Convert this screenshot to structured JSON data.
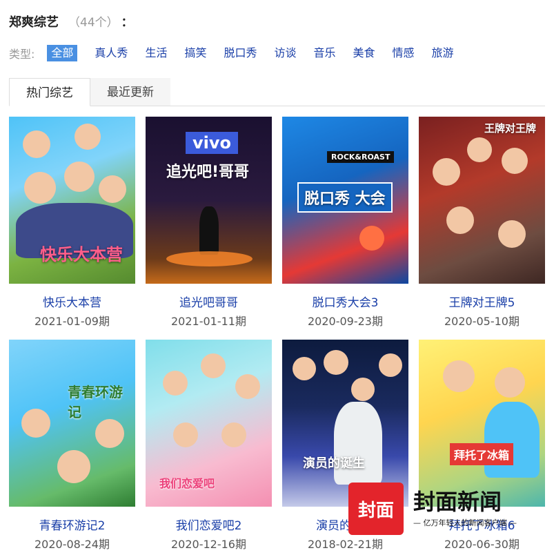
{
  "header": {
    "title": "郑爽综艺",
    "count": "（44个）",
    "colon": "："
  },
  "filters": {
    "label": "类型:",
    "items": [
      "全部",
      "真人秀",
      "生活",
      "搞笑",
      "脱口秀",
      "访谈",
      "音乐",
      "美食",
      "情感",
      "旅游"
    ]
  },
  "tabs": [
    "热门综艺",
    "最近更新"
  ],
  "shows": [
    {
      "name": "快乐大本营",
      "date": "2021-01-09期",
      "poster_text": "快乐大本营"
    },
    {
      "name": "追光吧哥哥",
      "date": "2021-01-11期",
      "poster_text": "追光吧!哥哥",
      "poster_sub": "vivo"
    },
    {
      "name": "脱口秀大会3",
      "date": "2020-09-23期",
      "poster_text": "脱口秀 大会",
      "poster_sub": "ROCK&ROAST"
    },
    {
      "name": "王牌对王牌5",
      "date": "2020-05-10期",
      "poster_text": "王牌对王牌"
    },
    {
      "name": "青春环游记2",
      "date": "2020-08-24期",
      "poster_text": "青春环游记"
    },
    {
      "name": "我们恋爱吧2",
      "date": "2020-12-16期",
      "poster_text": "我们恋爱吧"
    },
    {
      "name": "演员的诞生",
      "date": "2018-02-21期",
      "poster_text": "演员的诞生"
    },
    {
      "name": "拜托了冰箱6",
      "date": "2020-06-30期",
      "poster_text": "拜托了冰箱"
    }
  ],
  "watermark": {
    "logo": "封面",
    "title": "封面新闻",
    "subtitle": "— 亿万年轻人的新闻客户端 —"
  }
}
